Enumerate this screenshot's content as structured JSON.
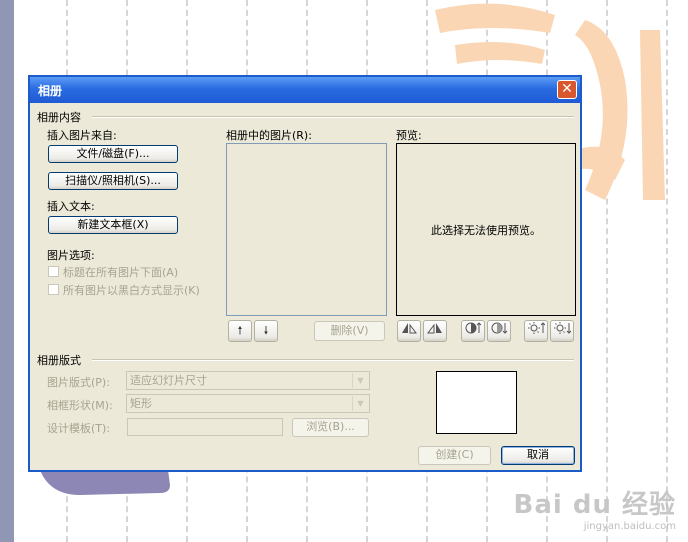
{
  "dialog": {
    "title": "相册",
    "close_icon": "close-icon"
  },
  "album_content": {
    "section_label": "相册内容",
    "insert_picture_from": "插入图片来自:",
    "file_disk_button": "文件/磁盘(F)...",
    "scanner_camera_button": "扫描仪/照相机(S)...",
    "insert_text": "插入文本:",
    "new_text_box_button": "新建文本框(X)",
    "picture_options": "图片选项:",
    "captions_below": "标题在所有图片下面(A)",
    "all_black_white": "所有图片以黑白方式显示(K)",
    "pictures_in_album": "相册中的图片(R):",
    "move_up_icon": "arrow-up-icon",
    "move_down_icon": "arrow-down-icon",
    "delete_button": "删除(V)",
    "preview_label": "预览:",
    "preview_message": "此选择无法使用预览。",
    "preview_tools": [
      "rotate-left-icon",
      "rotate-right-icon",
      "contrast-up-icon",
      "contrast-down-icon",
      "brightness-up-icon",
      "brightness-down-icon"
    ]
  },
  "album_layout": {
    "section_label": "相册版式",
    "picture_layout_label": "图片版式(P):",
    "picture_layout_value": "适应幻灯片尺寸",
    "frame_shape_label": "相框形状(M):",
    "frame_shape_value": "矩形",
    "design_template_label": "设计模板(T):",
    "design_template_value": "",
    "browse_button": "浏览(B)..."
  },
  "footer": {
    "create_button": "创建(C)",
    "cancel_button": "取消"
  },
  "watermark": {
    "brand": "Bai du 经验",
    "url": "jingyan.baidu.com"
  }
}
